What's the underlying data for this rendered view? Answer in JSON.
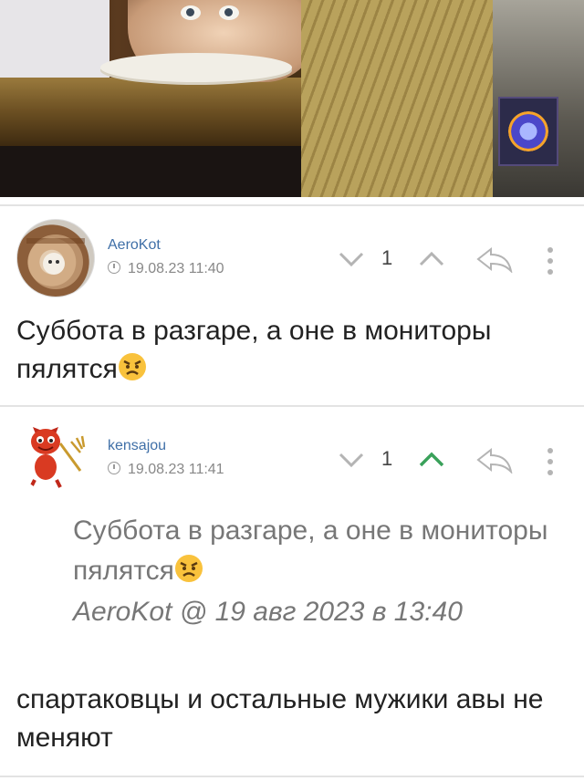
{
  "comments": [
    {
      "author": "AeroKot",
      "date": "19.08.23 11:40",
      "votes": "1",
      "upvoted": false,
      "text": "Суббота в разгаре, а оне в мониторы пялятся"
    },
    {
      "author": "kensajou",
      "date": "19.08.23 11:41",
      "votes": "1",
      "upvoted": true,
      "quote": {
        "text": "Суббота в разгаре, а оне в мониторы пялятся",
        "author": "AeroKot",
        "at": "@",
        "date": "19 авг 2023 в 13:40"
      },
      "text": "спартаковцы и остальные мужики авы не меняют"
    }
  ],
  "colors": {
    "username": "#3f6fa7",
    "upvote_active": "#3aa15a",
    "icon_gray": "#b4b4b4"
  },
  "icons": [
    "vote-down-icon",
    "vote-up-icon",
    "reply-icon",
    "more-icon",
    "clock-icon",
    "angry-emoji-icon"
  ]
}
